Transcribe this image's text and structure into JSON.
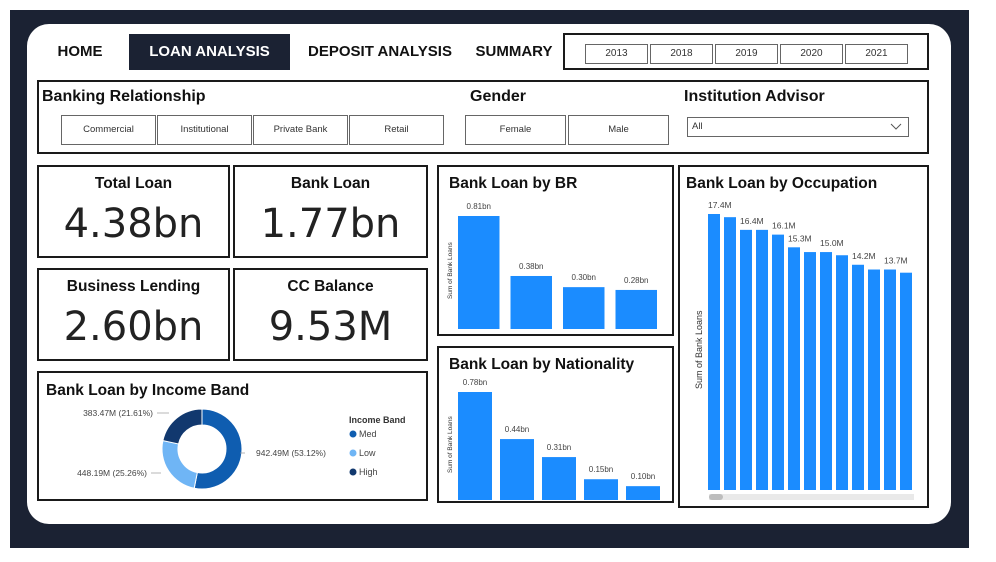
{
  "nav": {
    "tabs": [
      {
        "label": "HOME"
      },
      {
        "label": "LOAN ANALYSIS"
      },
      {
        "label": "DEPOSIT ANALYSIS"
      },
      {
        "label": "SUMMARY"
      }
    ],
    "active_tab": "LOAN ANALYSIS",
    "years": [
      "2013",
      "2018",
      "2019",
      "2020",
      "2021"
    ]
  },
  "filters": {
    "banking_relationship": {
      "label": "Banking Relationship",
      "options": [
        "Commercial",
        "Institutional",
        "Private Bank",
        "Retail"
      ]
    },
    "gender": {
      "label": "Gender",
      "options": [
        "Female",
        "Male"
      ]
    },
    "institution_advisor": {
      "label": "Institution Advisor",
      "selected": "All"
    }
  },
  "kpis": {
    "total_loan": {
      "title": "Total Loan",
      "value": "4.38bn"
    },
    "bank_loan": {
      "title": "Bank Loan",
      "value": "1.77bn"
    },
    "business_lending": {
      "title": "Business Lending",
      "value": "2.60bn"
    },
    "cc_balance": {
      "title": "CC Balance",
      "value": "9.53M"
    }
  },
  "colors": {
    "accent": "#1b8cff",
    "navy": "#1b2233",
    "donut_med": "#0f5db0",
    "donut_low": "#6fb5f5",
    "donut_high": "#11386e"
  },
  "chart_data": [
    {
      "id": "br",
      "type": "bar",
      "title": "Bank Loan by  BR",
      "ylabel": "Sum of Bank Loans",
      "values": [
        0.81,
        0.38,
        0.3,
        0.28
      ],
      "data_labels": [
        "0.81bn",
        "0.38bn",
        "0.30bn",
        "0.28bn"
      ],
      "ylim": [
        0,
        0.81
      ]
    },
    {
      "id": "nationality",
      "type": "bar",
      "title": "Bank Loan by Nationality",
      "ylabel": "Sum of Bank Loans",
      "values": [
        0.78,
        0.44,
        0.31,
        0.15,
        0.1
      ],
      "data_labels": [
        "0.78bn",
        "0.44bn",
        "0.31bn",
        "0.15bn",
        "0.10bn"
      ],
      "ylim": [
        0,
        0.78
      ]
    },
    {
      "id": "occupation",
      "type": "bar",
      "title": "Bank Loan by Occupation",
      "ylabel": "Sum of Bank Loans",
      "values": [
        17.4,
        17.2,
        16.4,
        16.4,
        16.1,
        15.3,
        15.0,
        15.0,
        14.8,
        14.2,
        13.9,
        13.9,
        13.7
      ],
      "data_labels": [
        "17.4M",
        "",
        "16.4M",
        "",
        "16.1M",
        "15.3M",
        "",
        "15.0M",
        "",
        "14.2M",
        "",
        "13.7M",
        ""
      ],
      "ylim": [
        0,
        17.4
      ]
    },
    {
      "id": "income_band",
      "type": "pie",
      "title": "Bank Loan by Income Band",
      "legend_title": "Income Band",
      "slices": [
        {
          "name": "Med",
          "value": 942.49,
          "label": "942.49M (53.12%)"
        },
        {
          "name": "Low",
          "value": 448.19,
          "label": "448.19M (25.26%)"
        },
        {
          "name": "High",
          "value": 383.47,
          "label": "383.47M (21.61%)"
        }
      ]
    }
  ]
}
